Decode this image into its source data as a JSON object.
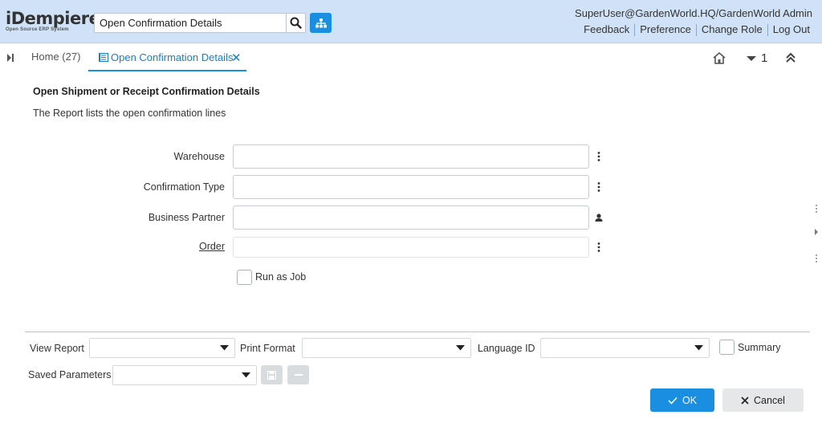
{
  "header": {
    "logo": {
      "main": "iDempiere",
      "sub": "Open Source ERP System"
    },
    "search": {
      "value": "Open Confirmation Details",
      "placeholder": ""
    },
    "user": "SuperUser@GardenWorld.HQ/GardenWorld Admin",
    "links": [
      "Feedback",
      "Preference",
      "Change Role",
      "Log Out"
    ]
  },
  "tabs": {
    "home": "Home (27)",
    "active": "Open Confirmation Details",
    "count": "1"
  },
  "content": {
    "title": "Open Shipment or Receipt Confirmation Details",
    "description": "The Report lists the open confirmation lines",
    "fields": [
      {
        "label": "Warehouse",
        "value": ""
      },
      {
        "label": "Confirmation Type",
        "value": ""
      },
      {
        "label": "Business Partner",
        "value": ""
      },
      {
        "label": "Order",
        "value": ""
      }
    ],
    "run_as_job": "Run as Job"
  },
  "bottom": {
    "view_report_label": "View Report",
    "print_format_label": "Print Format",
    "language_label": "Language ID",
    "summary_label": "Summary",
    "saved_params_label": "Saved Parameters",
    "ok_label": "OK",
    "cancel_label": "Cancel"
  },
  "colors": {
    "accent": "#1a8ee1",
    "header_bg": "#cfe2f7"
  }
}
